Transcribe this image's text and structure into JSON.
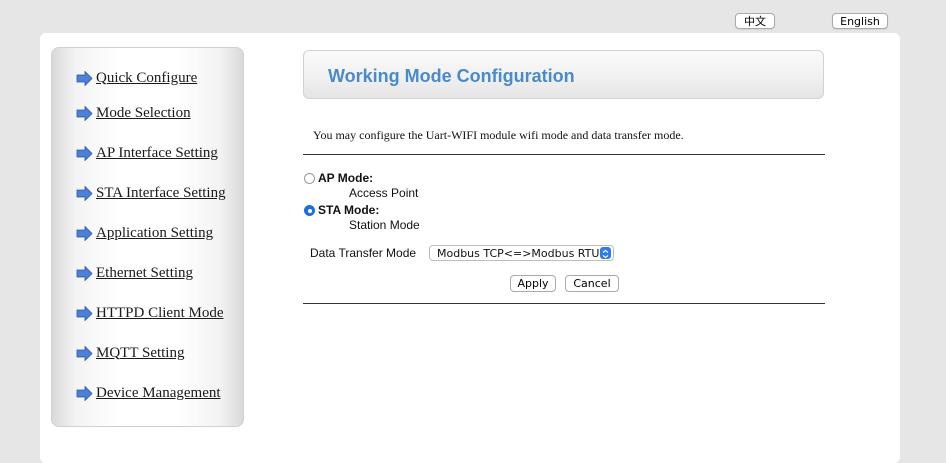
{
  "language": {
    "chinese_label": "中文",
    "english_label": "English"
  },
  "sidebar": {
    "items": [
      {
        "label": "Quick Configure"
      },
      {
        "label": "Mode Selection"
      },
      {
        "label": "AP Interface Setting"
      },
      {
        "label": "STA Interface Setting"
      },
      {
        "label": "Application Setting"
      },
      {
        "label": "Ethernet Setting"
      },
      {
        "label": "HTTPD Client Mode"
      },
      {
        "label": "MQTT Setting"
      },
      {
        "label": "Device Management"
      }
    ]
  },
  "main": {
    "title": "Working Mode Configuration",
    "description": "You may configure the Uart-WIFI module wifi mode and data transfer mode.",
    "modes": [
      {
        "label": "AP Mode:",
        "sublabel": "Access Point",
        "selected": false
      },
      {
        "label": "STA Mode:",
        "sublabel": "Station Mode",
        "selected": true
      }
    ],
    "data_transfer_mode": {
      "label": "Data Transfer Mode",
      "value": "Modbus TCP<=>Modbus RTU"
    },
    "apply_label": "Apply",
    "cancel_label": "Cancel"
  },
  "colors": {
    "title": "#4a8acb",
    "radio_selected": "#1e6fd9",
    "arrow": "#4d7fd6"
  },
  "icons": {
    "nav_item": "arrow-right-icon",
    "select": "chevron-updown-icon"
  }
}
